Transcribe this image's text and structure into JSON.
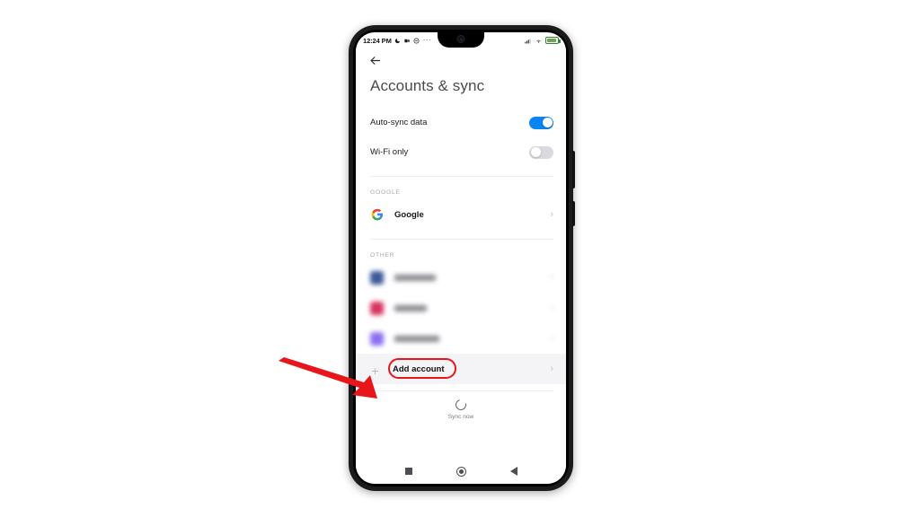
{
  "status_bar": {
    "time": "12:24 PM",
    "left_icons": [
      "moon-icon",
      "video-camera-icon",
      "dnd-icon"
    ],
    "overflow_dots": "···",
    "right_icons": [
      "signal-icon",
      "wifi-icon",
      "battery-icon"
    ],
    "battery_color": "#6aa84f"
  },
  "header": {
    "back_icon": "back-arrow-icon",
    "title": "Accounts & sync"
  },
  "settings": [
    {
      "label": "Auto-sync data",
      "toggle": "on"
    },
    {
      "label": "Wi-Fi only",
      "toggle": "off"
    }
  ],
  "sections": [
    {
      "header": "GOOGLE",
      "rows": [
        {
          "label": "Google",
          "icon": "google-logo-icon",
          "blurred": false,
          "chevron": "›"
        }
      ]
    },
    {
      "header": "OTHER",
      "rows": [
        {
          "label": "Facebook",
          "icon": "facebook-icon",
          "blurred": true,
          "icon_color": "#3b5998",
          "chevron": "›",
          "text_width": "46px"
        },
        {
          "label": "Instagram",
          "icon": "instagram-icon",
          "blurred": true,
          "icon_color": "#d8335f",
          "chevron": "›",
          "text_width": "36px"
        },
        {
          "label": "Messenger",
          "icon": "messenger-icon",
          "blurred": true,
          "icon_color": "#8b6ff0",
          "chevron": "›",
          "text_width": "50px"
        }
      ]
    }
  ],
  "add_account": {
    "label": "Add account",
    "plus_icon": "plus-icon",
    "chevron": "›",
    "highlight_color": "#e8151b"
  },
  "footer": {
    "sync_icon": "sync-refresh-icon",
    "sync_label": "Sync now"
  },
  "nav_bar": {
    "recents": "square-recents-icon",
    "home": "circle-home-icon",
    "back": "triangle-back-icon"
  },
  "annotation": {
    "arrow": "red-arrow-annotation",
    "arrow_color": "#e8151b"
  }
}
